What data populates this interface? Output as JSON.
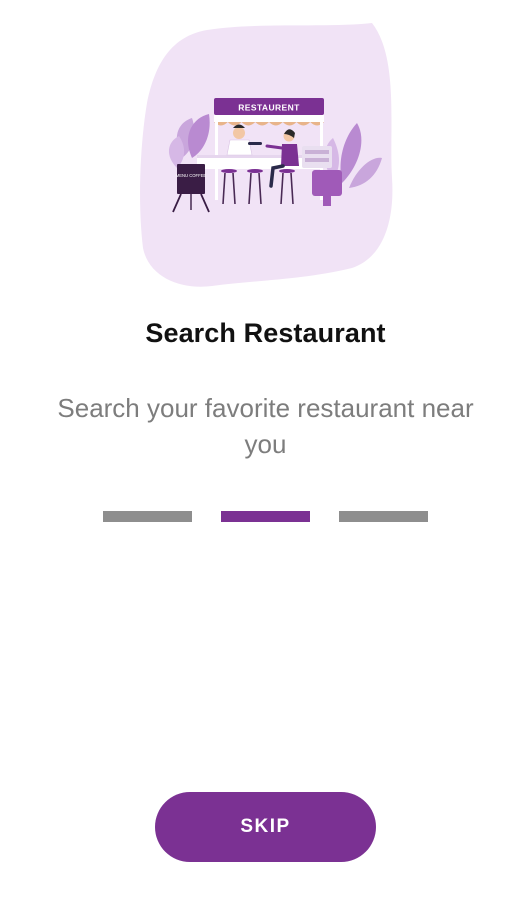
{
  "colors": {
    "accent": "#7b3193",
    "indicator_inactive": "#8e8e8e",
    "illustration_blob": "#f1e3f6",
    "title_text": "#111111",
    "subtitle_text": "#7d7d7d"
  },
  "illustration": {
    "sign_text": "RESTAURENT",
    "board_text": "MENU COFFEE"
  },
  "onboarding": {
    "title": "Search Restaurant",
    "subtitle": "Search your favorite restaurant near you",
    "page_count": 3,
    "current_page": 2
  },
  "skip_label": "SKIP"
}
